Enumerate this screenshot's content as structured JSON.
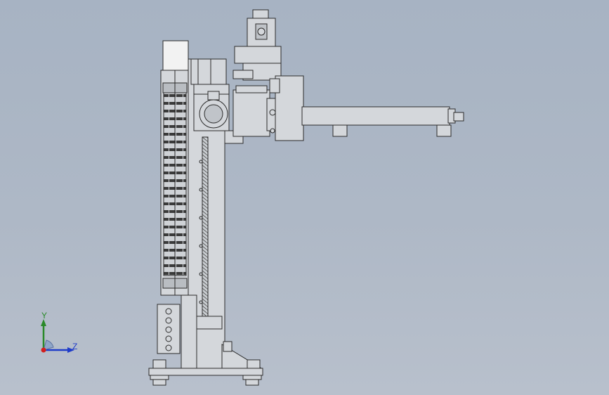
{
  "viewport": {
    "background_top": "#a7b3c3",
    "background_bottom": "#b8c0cc",
    "part_fill": "#d4d7db",
    "part_edge": "#2b2b2b"
  },
  "triad": {
    "y_label": "Y",
    "z_label": "Z",
    "y_color": "#2a8a2a",
    "z_color": "#1f3cc9",
    "origin_color": "#d21f1f"
  }
}
